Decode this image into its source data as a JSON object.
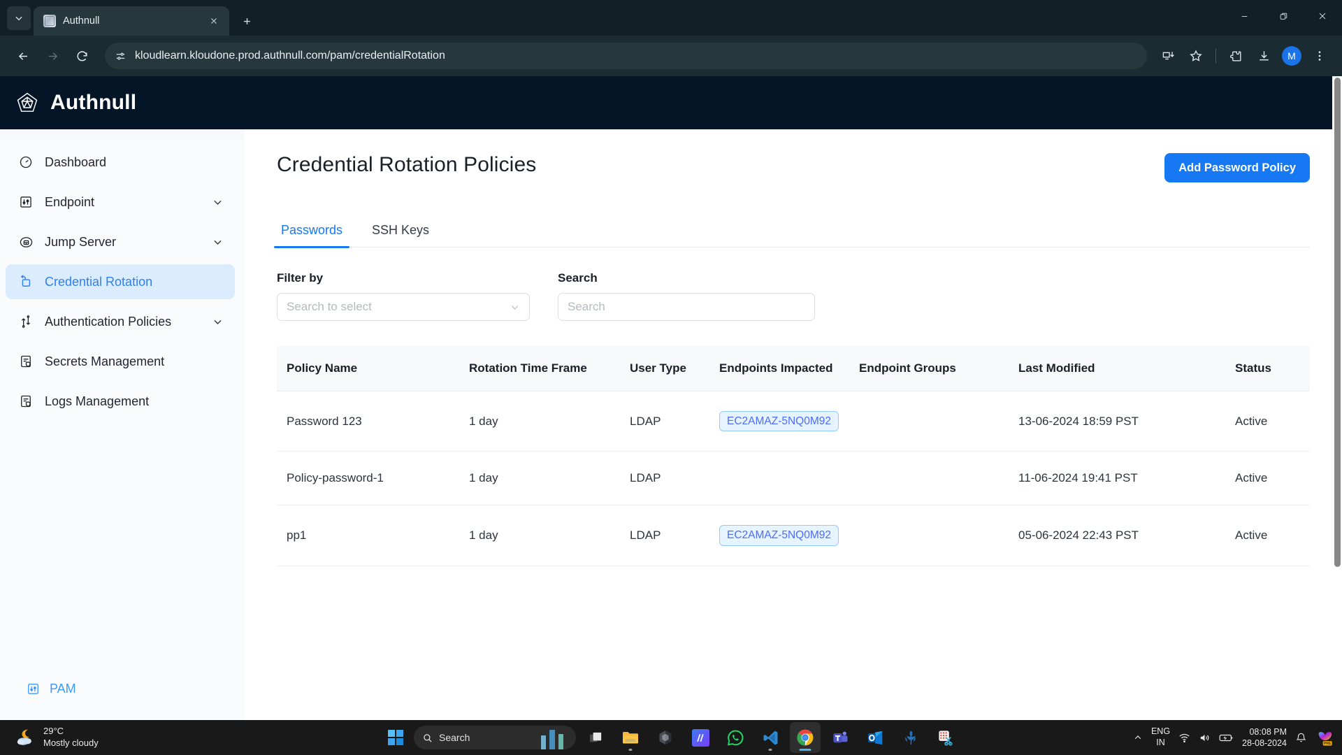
{
  "browser": {
    "tab": {
      "title": "Authnull",
      "favicon_icon": "site-favicon",
      "close_icon": "close-icon"
    },
    "tabstrip_dropdown_icon": "chevron-down-icon",
    "new_tab_icon": "plus-icon",
    "window_controls": {
      "minimize": "minimize-icon",
      "maximize": "maximize-icon",
      "close": "close-icon"
    },
    "nav": {
      "back_icon": "back-arrow-icon",
      "forward_icon": "forward-arrow-icon",
      "reload_icon": "reload-icon"
    },
    "omnibox": {
      "site_info_icon": "site-settings-icon",
      "url": "kloudlearn.kloudone.prod.authnull.com/pam/credentialRotation"
    },
    "toolbar_icons": [
      "install-app-icon",
      "bookmark-star-icon",
      "extensions-icon",
      "downloads-icon"
    ],
    "profile": {
      "initial": "M"
    },
    "menu_icon": "three-dot-menu-icon"
  },
  "app": {
    "brand": {
      "name": "Authnull",
      "logo_icon": "authnull-pentagon-logo"
    },
    "colors": {
      "header_bg": "#041527",
      "accent": "#1678f2",
      "active_nav_bg": "#dbecfe",
      "status_active": "#2fa02f",
      "chip_border": "#91caff",
      "chip_bg": "#e6f4ff",
      "chip_text": "#4d6bfe"
    }
  },
  "sidebar": {
    "items": [
      {
        "label": "Dashboard",
        "icon": "dashboard-gauge-icon",
        "expandable": false,
        "active": false
      },
      {
        "label": "Endpoint",
        "icon": "endpoint-sliders-icon",
        "expandable": true,
        "active": false
      },
      {
        "label": "Jump Server",
        "icon": "jump-server-icon",
        "expandable": true,
        "active": false
      },
      {
        "label": "Credential Rotation",
        "icon": "credential-rotation-icon",
        "expandable": false,
        "active": true
      },
      {
        "label": "Authentication Policies",
        "icon": "auth-policies-icon",
        "expandable": true,
        "active": false
      },
      {
        "label": "Secrets Management",
        "icon": "secrets-document-icon",
        "expandable": false,
        "active": false
      },
      {
        "label": "Logs Management",
        "icon": "logs-document-icon",
        "expandable": false,
        "active": false
      }
    ],
    "footer": {
      "label": "PAM",
      "icon": "pam-sliders-icon"
    }
  },
  "main": {
    "title": "Credential Rotation Policies",
    "add_button": "Add Password Policy",
    "tabs": [
      {
        "label": "Passwords",
        "active": true
      },
      {
        "label": "SSH Keys",
        "active": false
      }
    ],
    "filter": {
      "label": "Filter by",
      "placeholder": "Search to select",
      "value": "",
      "caret_icon": "chevron-down-icon"
    },
    "search": {
      "label": "Search",
      "placeholder": "Search",
      "value": ""
    },
    "table": {
      "columns": [
        "Policy Name",
        "Rotation Time Frame",
        "User Type",
        "Endpoints Impacted",
        "Endpoint Groups",
        "Last Modified",
        "Status"
      ],
      "rows": [
        {
          "policy_name": "Password 123",
          "rotation_time_frame": "1 day",
          "user_type": "LDAP",
          "endpoints_impacted": "EC2AMAZ-5NQ0M92",
          "endpoint_groups": "",
          "last_modified": "13-06-2024 18:59 PST",
          "status": "Active"
        },
        {
          "policy_name": "Policy-password-1",
          "rotation_time_frame": "1 day",
          "user_type": "LDAP",
          "endpoints_impacted": "",
          "endpoint_groups": "",
          "last_modified": "11-06-2024 19:41 PST",
          "status": "Active"
        },
        {
          "policy_name": "pp1",
          "rotation_time_frame": "1 day",
          "user_type": "LDAP",
          "endpoints_impacted": "EC2AMAZ-5NQ0M92",
          "endpoint_groups": "",
          "last_modified": "05-06-2024 22:43 PST",
          "status": "Active"
        }
      ]
    }
  },
  "taskbar": {
    "weather": {
      "temperature": "29°C",
      "condition": "Mostly cloudy",
      "icon": "moon-cloud-icon"
    },
    "start_icon": "windows-start-icon",
    "search": {
      "placeholder": "Search",
      "icon": "search-icon"
    },
    "apps": [
      {
        "name": "task-view",
        "icon": "task-view-icon",
        "running": false,
        "focused": false
      },
      {
        "name": "file-explorer",
        "icon": "folder-icon",
        "running": true,
        "focused": false
      },
      {
        "name": "copilot",
        "icon": "copilot-icon",
        "running": false,
        "focused": false
      },
      {
        "name": "app-blue",
        "icon": "m-app-icon",
        "running": false,
        "focused": false
      },
      {
        "name": "whatsapp",
        "icon": "whatsapp-icon",
        "running": false,
        "focused": false
      },
      {
        "name": "vs-code",
        "icon": "vscode-icon",
        "running": true,
        "focused": false
      },
      {
        "name": "google-chrome",
        "icon": "chrome-icon",
        "running": true,
        "focused": true
      },
      {
        "name": "microsoft-teams",
        "icon": "teams-icon",
        "running": false,
        "focused": false
      },
      {
        "name": "outlook",
        "icon": "outlook-icon",
        "running": false,
        "focused": false
      },
      {
        "name": "kubernetes",
        "icon": "k8s-helm-icon",
        "running": false,
        "focused": false
      },
      {
        "name": "snipping-tool",
        "icon": "snipping-tool-icon",
        "running": false,
        "focused": false
      }
    ],
    "tray": {
      "overflow_icon": "chevron-up-icon",
      "language": {
        "line1": "ENG",
        "line2": "IN"
      },
      "wifi_icon": "wifi-icon",
      "volume_icon": "volume-icon",
      "battery_icon": "battery-icon",
      "clock": {
        "time": "08:08 PM",
        "date": "28-08-2024"
      },
      "notification_icon": "bell-icon",
      "copilot_icon": "copilot-pre-icon",
      "copilot_badge": "PRE"
    }
  }
}
